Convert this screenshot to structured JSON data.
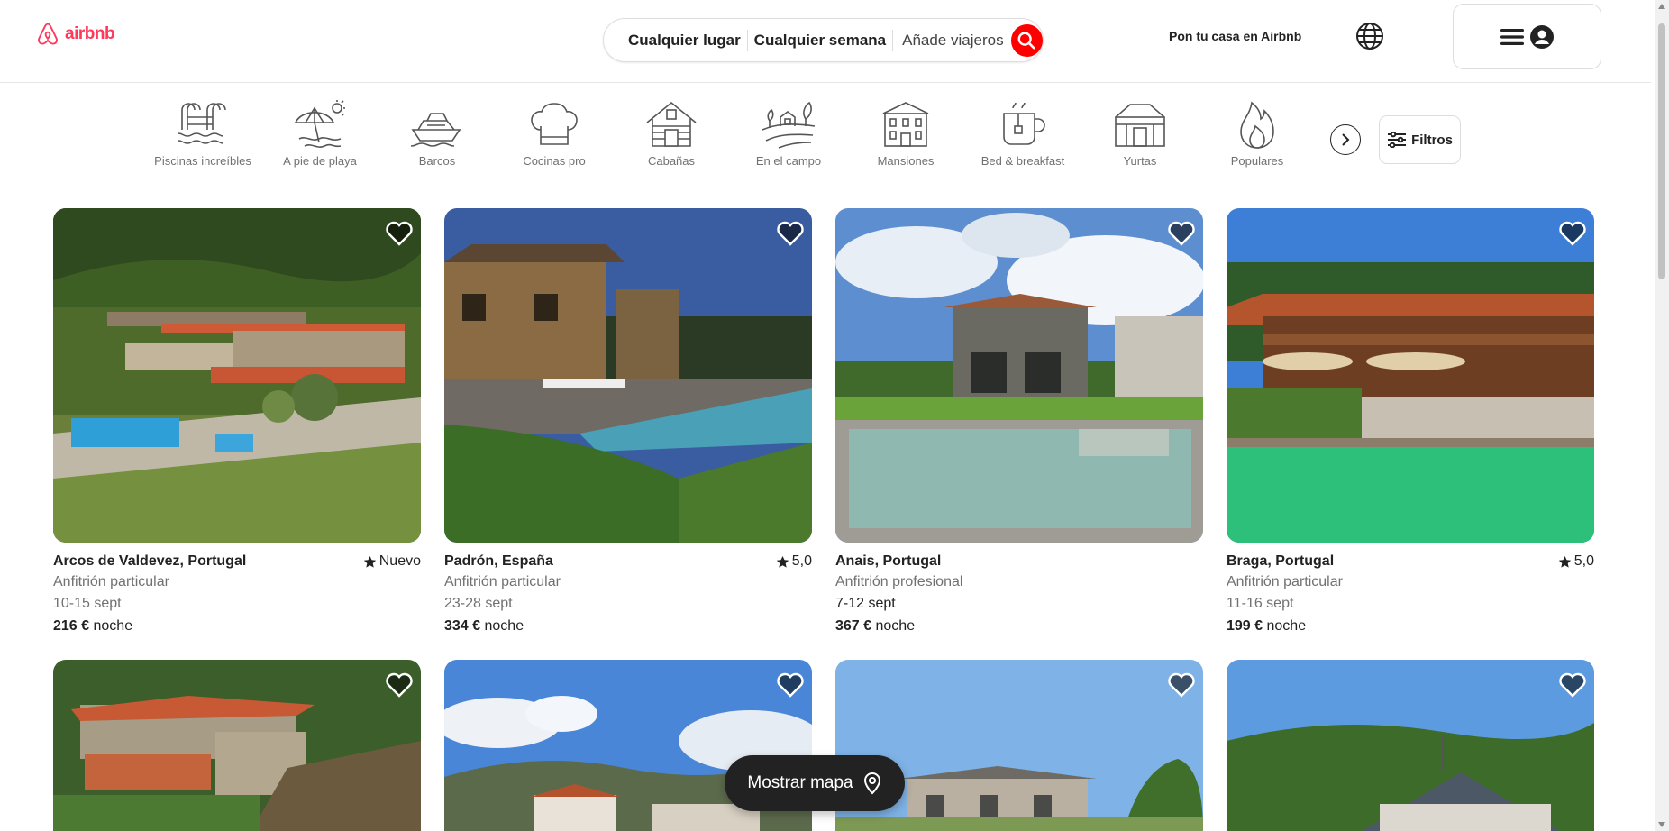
{
  "brand": {
    "name": "airbnb",
    "color": "#ff385c"
  },
  "search": {
    "location": "Cualquier lugar",
    "week": "Cualquier semana",
    "guests_placeholder": "Añade viajeros",
    "button_icon": "search-icon",
    "button_color": "#ff0000"
  },
  "header": {
    "host_link": "Pon tu casa en Airbnb",
    "language_icon": "globe-icon",
    "menu_icons": [
      "menu-icon",
      "user-icon"
    ]
  },
  "categories": [
    {
      "label": "Piscinas increíbles",
      "icon": "pool-icon"
    },
    {
      "label": "A pie de playa",
      "icon": "beach-icon"
    },
    {
      "label": "Barcos",
      "icon": "boat-icon"
    },
    {
      "label": "Cocinas pro",
      "icon": "chef-hat-icon"
    },
    {
      "label": "Cabañas",
      "icon": "cabin-icon"
    },
    {
      "label": "En el campo",
      "icon": "countryside-icon"
    },
    {
      "label": "Mansiones",
      "icon": "mansion-icon"
    },
    {
      "label": "Bed & breakfast",
      "icon": "tea-icon"
    },
    {
      "label": "Yurtas",
      "icon": "yurt-icon"
    },
    {
      "label": "Populares",
      "icon": "flame-icon"
    }
  ],
  "filters_label": "Filtros",
  "listings": [
    {
      "location": "Arcos de Valdevez, Portugal",
      "rating": "Nuevo",
      "host": "Anfitrión particular",
      "dates": "10-15 sept",
      "price": "216 €",
      "price_unit": "noche"
    },
    {
      "location": "Padrón, España",
      "rating": "5,0",
      "host": "Anfitrión particular",
      "dates": "23-28 sept",
      "price": "334 €",
      "price_unit": "noche"
    },
    {
      "location": "Anais, Portugal",
      "rating": "",
      "host": "Anfitrión profesional",
      "dates": "7-12 sept",
      "price": "367 €",
      "price_unit": "noche"
    },
    {
      "location": "Braga, Portugal",
      "rating": "5,0",
      "host": "Anfitrión particular",
      "dates": "11-16 sept",
      "price": "199 €",
      "price_unit": "noche"
    }
  ],
  "map_button": {
    "label": "Mostrar mapa",
    "icon": "map-pin-icon"
  }
}
